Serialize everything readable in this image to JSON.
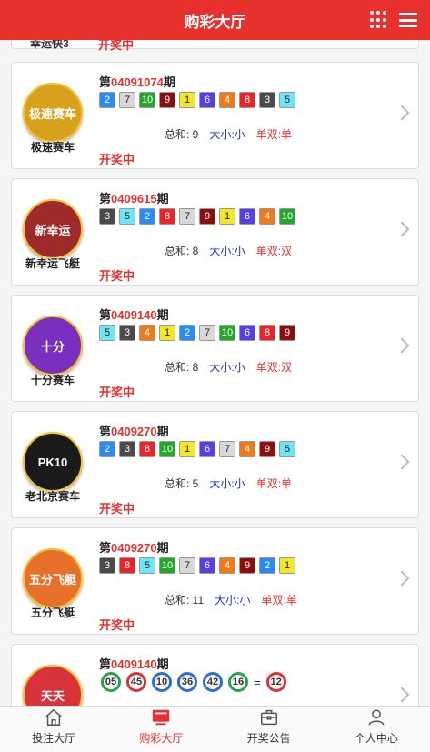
{
  "header": {
    "title": "购彩大厅"
  },
  "cut_card": {
    "name": "幸运快3",
    "status": "开奖中"
  },
  "cards": [
    {
      "logo_text": "极速赛车",
      "name": "极速赛车",
      "logo_color": "#d7a11b",
      "period_prefix": "第",
      "period_number": "04091074",
      "period_suffix": "期",
      "balls": [
        {
          "n": "2",
          "c": "#2a8bf0"
        },
        {
          "n": "7",
          "c": "#d8d8d8"
        },
        {
          "n": "10",
          "c": "#22a82a"
        },
        {
          "n": "9",
          "c": "#8c0f0f"
        },
        {
          "n": "1",
          "c": "#f6e62a"
        },
        {
          "n": "6",
          "c": "#5a3fe0"
        },
        {
          "n": "4",
          "c": "#f07a1a"
        },
        {
          "n": "8",
          "c": "#e8252a"
        },
        {
          "n": "3",
          "c": "#4a4a4a"
        },
        {
          "n": "5",
          "c": "#6ee6f5"
        }
      ],
      "sum": "总和: 9",
      "size": "大小:小",
      "parity": "单双:单",
      "status": "开奖中"
    },
    {
      "logo_text": "新幸运",
      "name": "新幸运飞艇",
      "logo_color": "#9e2a2a",
      "period_prefix": "第",
      "period_number": "0409615",
      "period_suffix": "期",
      "balls": [
        {
          "n": "3",
          "c": "#4a4a4a"
        },
        {
          "n": "5",
          "c": "#6ee6f5"
        },
        {
          "n": "2",
          "c": "#2a8bf0"
        },
        {
          "n": "8",
          "c": "#e8252a"
        },
        {
          "n": "7",
          "c": "#d8d8d8"
        },
        {
          "n": "9",
          "c": "#8c0f0f"
        },
        {
          "n": "1",
          "c": "#f6e62a"
        },
        {
          "n": "6",
          "c": "#5a3fe0"
        },
        {
          "n": "4",
          "c": "#f07a1a"
        },
        {
          "n": "10",
          "c": "#22a82a"
        }
      ],
      "sum": "总和: 8",
      "size": "大小:小",
      "parity": "单双:双",
      "status": "开奖中"
    },
    {
      "logo_text": "十分",
      "name": "十分赛车",
      "logo_color": "#7b2fbf",
      "period_prefix": "第",
      "period_number": "0409140",
      "period_suffix": "期",
      "balls": [
        {
          "n": "5",
          "c": "#6ee6f5"
        },
        {
          "n": "3",
          "c": "#4a4a4a"
        },
        {
          "n": "4",
          "c": "#f07a1a"
        },
        {
          "n": "1",
          "c": "#f6e62a"
        },
        {
          "n": "2",
          "c": "#2a8bf0"
        },
        {
          "n": "7",
          "c": "#d8d8d8"
        },
        {
          "n": "10",
          "c": "#22a82a"
        },
        {
          "n": "6",
          "c": "#5a3fe0"
        },
        {
          "n": "8",
          "c": "#e8252a"
        },
        {
          "n": "9",
          "c": "#8c0f0f"
        }
      ],
      "sum": "总和: 8",
      "size": "大小:小",
      "parity": "单双:双",
      "status": "开奖中"
    },
    {
      "logo_text": "PK10",
      "name": "老北京赛车",
      "logo_color": "#1a1a1a",
      "period_prefix": "第",
      "period_number": "0409270",
      "period_suffix": "期",
      "balls": [
        {
          "n": "2",
          "c": "#2a8bf0"
        },
        {
          "n": "3",
          "c": "#4a4a4a"
        },
        {
          "n": "8",
          "c": "#e8252a"
        },
        {
          "n": "10",
          "c": "#22a82a"
        },
        {
          "n": "1",
          "c": "#f6e62a"
        },
        {
          "n": "6",
          "c": "#5a3fe0"
        },
        {
          "n": "7",
          "c": "#d8d8d8"
        },
        {
          "n": "4",
          "c": "#f07a1a"
        },
        {
          "n": "9",
          "c": "#8c0f0f"
        },
        {
          "n": "5",
          "c": "#6ee6f5"
        }
      ],
      "sum": "总和: 5",
      "size": "大小:小",
      "parity": "单双:单",
      "status": "开奖中"
    },
    {
      "logo_text": "五分飞艇",
      "name": "五分飞艇",
      "logo_color": "#e8702a",
      "period_prefix": "第",
      "period_number": "0409270",
      "period_suffix": "期",
      "balls": [
        {
          "n": "3",
          "c": "#4a4a4a"
        },
        {
          "n": "8",
          "c": "#e8252a"
        },
        {
          "n": "5",
          "c": "#6ee6f5"
        },
        {
          "n": "10",
          "c": "#22a82a"
        },
        {
          "n": "7",
          "c": "#d8d8d8"
        },
        {
          "n": "6",
          "c": "#5a3fe0"
        },
        {
          "n": "4",
          "c": "#f07a1a"
        },
        {
          "n": "9",
          "c": "#8c0f0f"
        },
        {
          "n": "2",
          "c": "#2a8bf0"
        },
        {
          "n": "1",
          "c": "#f6e62a"
        }
      ],
      "sum": "总和: 11",
      "size": "大小:小",
      "parity": "单双:单",
      "status": "开奖中"
    }
  ],
  "last_card": {
    "logo_text": "天天",
    "logo_color": "#d8333b",
    "period_prefix": "第",
    "period_number": "0409140",
    "period_suffix": "期",
    "balls": [
      {
        "n": "05",
        "t": "green"
      },
      {
        "n": "45",
        "t": "red"
      },
      {
        "n": "10",
        "t": "blue"
      },
      {
        "n": "36",
        "t": "blue"
      },
      {
        "n": "42",
        "t": "blue"
      },
      {
        "n": "16",
        "t": "green"
      }
    ],
    "eq": "=",
    "special": {
      "n": "12",
      "t": "red"
    }
  },
  "tabbar": {
    "tabs": [
      {
        "label": "投注大厅",
        "icon": "home-icon"
      },
      {
        "label": "购彩大厅",
        "icon": "monitor-icon",
        "active": true
      },
      {
        "label": "开奖公告",
        "icon": "briefcase-icon"
      },
      {
        "label": "个人中心",
        "icon": "user-icon"
      }
    ]
  }
}
